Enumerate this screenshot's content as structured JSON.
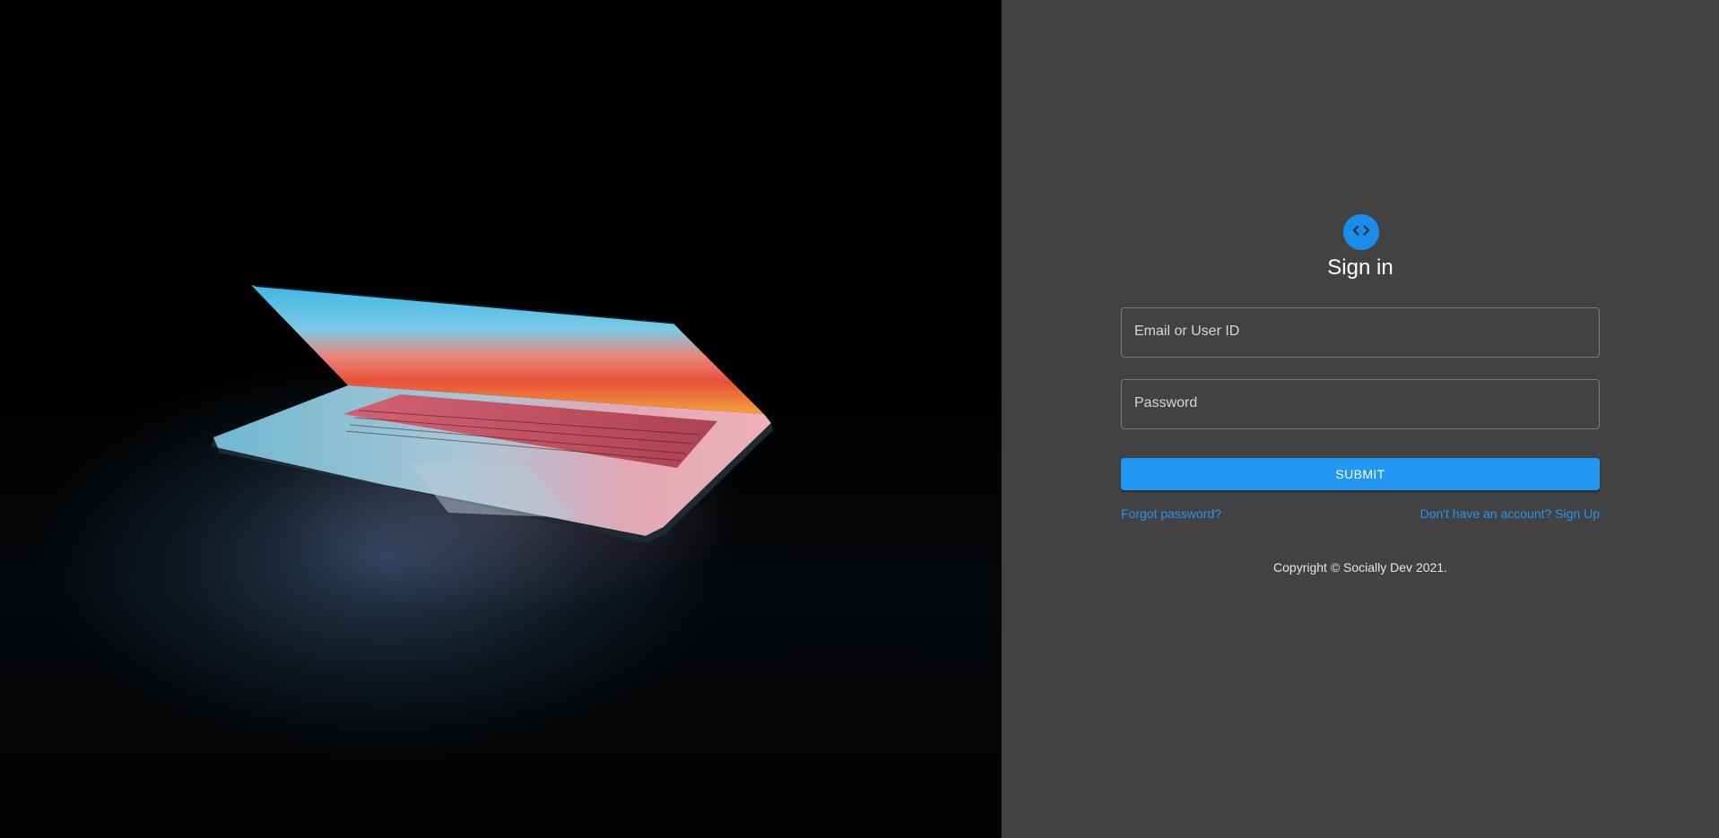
{
  "hero": {
    "image": "laptop-in-dark-photo"
  },
  "signin": {
    "icon": "code-brackets-icon",
    "title": "Sign in",
    "email_placeholder": "Email or User ID",
    "password_placeholder": "Password",
    "submit_label": "SUBMIT",
    "forgot_label": "Forgot password?",
    "signup_label": "Don't have an account? Sign Up",
    "copyright": "Copyright © Socially Dev 2021."
  },
  "colors": {
    "panel_bg": "#424242",
    "accent": "#2196f3",
    "avatar_bg": "#1a8de9"
  }
}
